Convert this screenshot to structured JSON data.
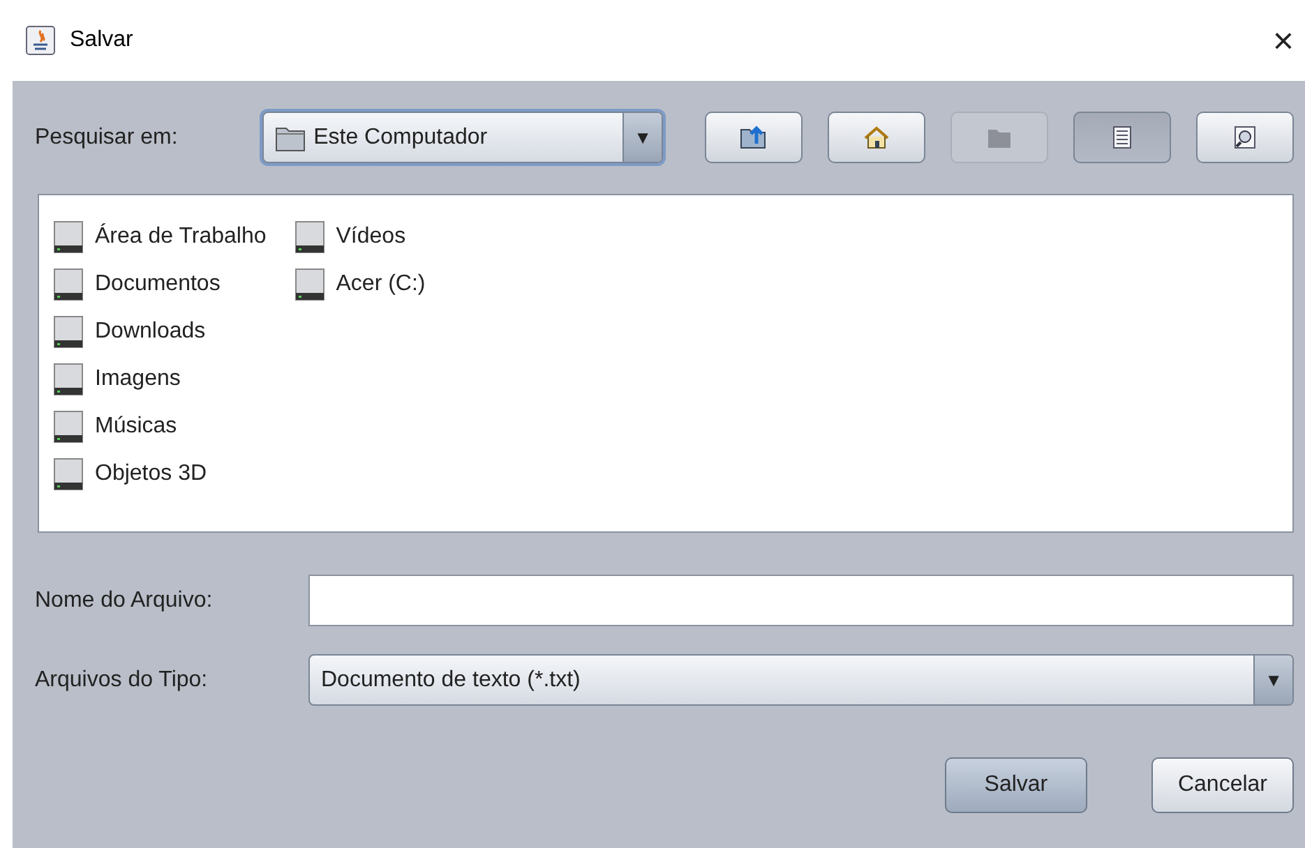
{
  "window": {
    "title": "Salvar",
    "close": "×"
  },
  "look_in": {
    "label": "Pesquisar em:",
    "value": "Este Computador",
    "arrow": "▼"
  },
  "toolbar": [
    {
      "kind": "up",
      "disabled": false,
      "selected": false
    },
    {
      "kind": "home",
      "disabled": false,
      "selected": false
    },
    {
      "kind": "newfolder",
      "disabled": true,
      "selected": false
    },
    {
      "kind": "list",
      "disabled": false,
      "selected": true
    },
    {
      "kind": "details",
      "disabled": false,
      "selected": false
    }
  ],
  "files": [
    {
      "name": "Área de Trabalho"
    },
    {
      "name": "Documentos"
    },
    {
      "name": "Downloads"
    },
    {
      "name": "Imagens"
    },
    {
      "name": "Músicas"
    },
    {
      "name": "Objetos 3D"
    },
    {
      "name": "Vídeos"
    },
    {
      "name": "Acer (C:)"
    }
  ],
  "file_name": {
    "label": "Nome do Arquivo:"
  },
  "file_type": {
    "label": "Arquivos do Tipo:",
    "value": "Documento de texto (*.txt)",
    "arrow": "▼"
  },
  "buttons": [
    {
      "label": "Salvar",
      "default": true
    },
    {
      "label": "Cancelar",
      "default": false
    }
  ]
}
